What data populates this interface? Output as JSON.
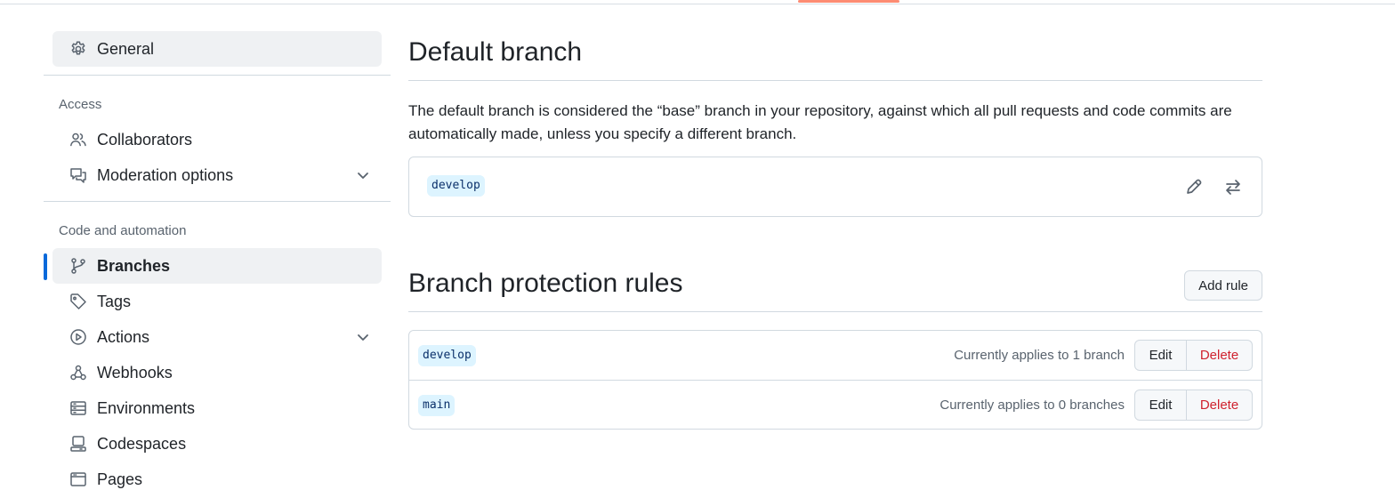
{
  "sidebar": {
    "general": {
      "label": "General",
      "icon": "gear-icon"
    },
    "groups": [
      {
        "title": "Access",
        "items": [
          {
            "label": "Collaborators",
            "icon": "people-icon"
          },
          {
            "label": "Moderation options",
            "icon": "comment-discussion-icon",
            "expandable": true
          }
        ]
      },
      {
        "title": "Code and automation",
        "items": [
          {
            "label": "Branches",
            "icon": "git-branch-icon",
            "active": true
          },
          {
            "label": "Tags",
            "icon": "tag-icon"
          },
          {
            "label": "Actions",
            "icon": "play-icon",
            "expandable": true
          },
          {
            "label": "Webhooks",
            "icon": "webhook-icon"
          },
          {
            "label": "Environments",
            "icon": "server-icon"
          },
          {
            "label": "Codespaces",
            "icon": "codespaces-icon"
          },
          {
            "label": "Pages",
            "icon": "browser-icon"
          }
        ]
      }
    ]
  },
  "default_branch": {
    "title": "Default branch",
    "description": "The default branch is considered the “base” branch in your repository, against which all pull requests and code commits are automatically made, unless you specify a different branch.",
    "branch": "develop"
  },
  "protection": {
    "title": "Branch protection rules",
    "add_label": "Add rule",
    "rules": [
      {
        "pattern": "develop",
        "applies": "Currently applies to 1 branch",
        "edit": "Edit",
        "delete": "Delete"
      },
      {
        "pattern": "main",
        "applies": "Currently applies to 0 branches",
        "edit": "Edit",
        "delete": "Delete"
      }
    ]
  },
  "colors": {
    "accent": "#0969da",
    "tab_underline": "#fd8c73",
    "danger": "#cf222e",
    "pill_bg": "#ddf4ff"
  }
}
